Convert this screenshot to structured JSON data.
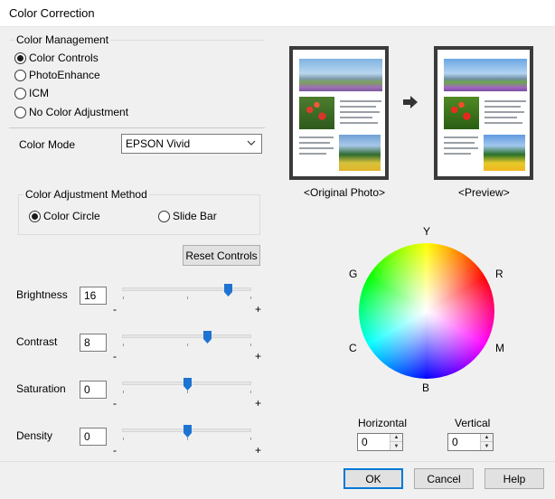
{
  "window": {
    "title": "Color Correction"
  },
  "color_management": {
    "group_label": "Color Management",
    "options": [
      {
        "label": "Color Controls",
        "checked": true
      },
      {
        "label": "PhotoEnhance",
        "checked": false
      },
      {
        "label": "ICM",
        "checked": false
      },
      {
        "label": "No Color Adjustment",
        "checked": false
      }
    ]
  },
  "color_mode": {
    "label": "Color Mode",
    "value": "EPSON Vivid"
  },
  "adjustment_method": {
    "group_label": "Color Adjustment Method",
    "options": [
      {
        "label": "Color Circle",
        "checked": true
      },
      {
        "label": "Slide Bar",
        "checked": false
      }
    ]
  },
  "reset_button": "Reset Controls",
  "sliders": [
    {
      "label": "Brightness",
      "value": "16",
      "level": 16
    },
    {
      "label": "Contrast",
      "value": "8",
      "level": 8
    },
    {
      "label": "Saturation",
      "value": "0",
      "level": 0
    },
    {
      "label": "Density",
      "value": "0",
      "level": 0
    }
  ],
  "slider_minus": "-",
  "slider_plus": "+",
  "preview": {
    "original_caption": "<Original Photo>",
    "preview_caption": "<Preview>",
    "arrow_icon": "right-arrow-icon"
  },
  "color_circle": {
    "labels": {
      "Y": "Y",
      "R": "R",
      "M": "M",
      "B": "B",
      "C": "C",
      "G": "G"
    },
    "crosshair": "+"
  },
  "offsets": {
    "horizontal_label": "Horizontal",
    "horizontal_value": "0",
    "vertical_label": "Vertical",
    "vertical_value": "0"
  },
  "buttons": {
    "ok": "OK",
    "cancel": "Cancel",
    "help": "Help"
  },
  "colors": {
    "accent": "#0078d7",
    "slider_thumb": "#1e73d2"
  }
}
